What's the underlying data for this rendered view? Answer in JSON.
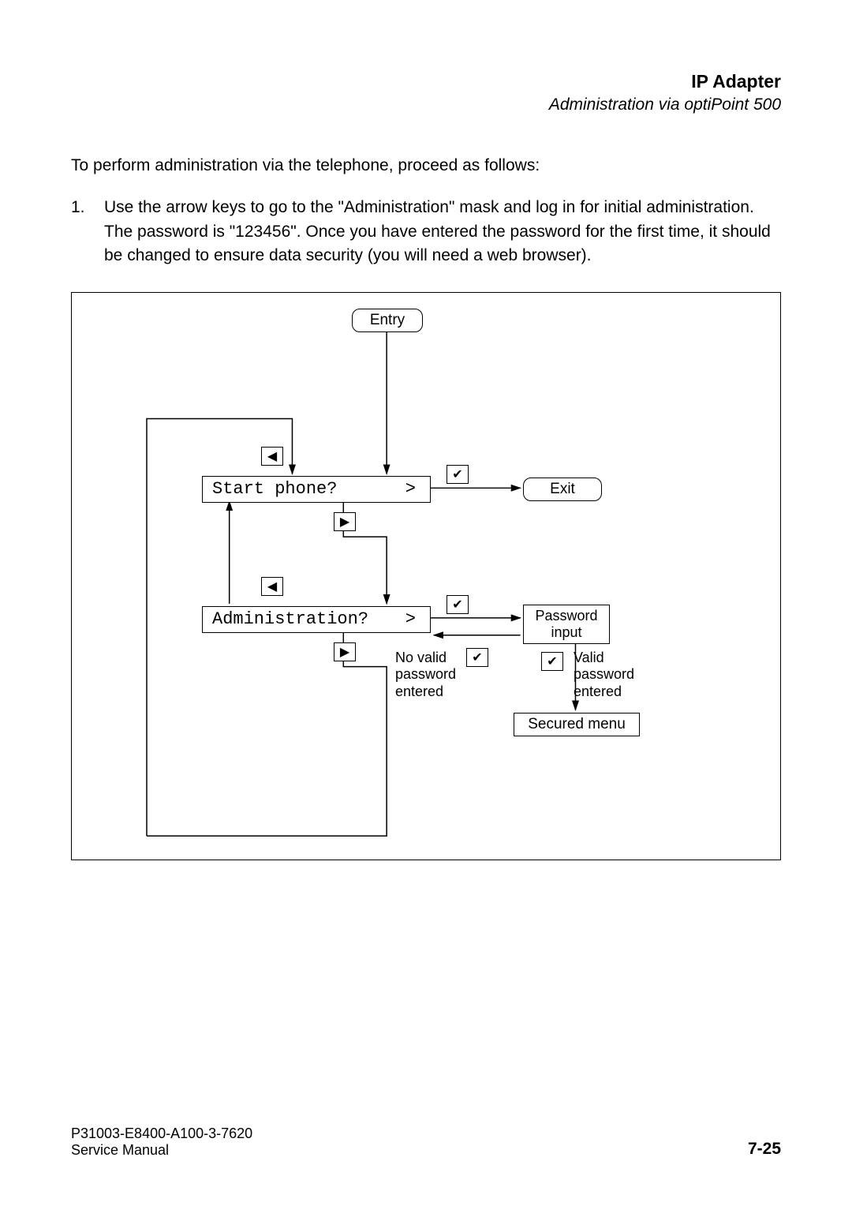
{
  "header": {
    "title": "IP Adapter",
    "subtitle": "Administration via optiPoint 500"
  },
  "intro": "To perform administration via the telephone, proceed as follows:",
  "list": {
    "num": "1.",
    "text": "Use the arrow keys to go to the \"Administration\" mask and log in for initial administration. The password is \"123456\". Once you have entered the password for the first time, it should be changed to ensure data security (you will need a web browser)."
  },
  "flow": {
    "entry": "Entry",
    "start_phone": "Start phone?",
    "exit": "Exit",
    "administration": "Administration?",
    "password_input_l1": "Password",
    "password_input_l2": "input",
    "secured_menu": "Secured menu",
    "no_valid_l1": "No valid",
    "no_valid_l2": "password",
    "no_valid_l3": "entered",
    "valid_l1": "Valid",
    "valid_l2": "password",
    "valid_l3": "entered",
    "prompt": ">",
    "left": "◀",
    "right": "▶",
    "check": "✔"
  },
  "footer": {
    "code": "P31003-E8400-A100-3-7620",
    "manual": "Service Manual",
    "page": "7-25"
  }
}
